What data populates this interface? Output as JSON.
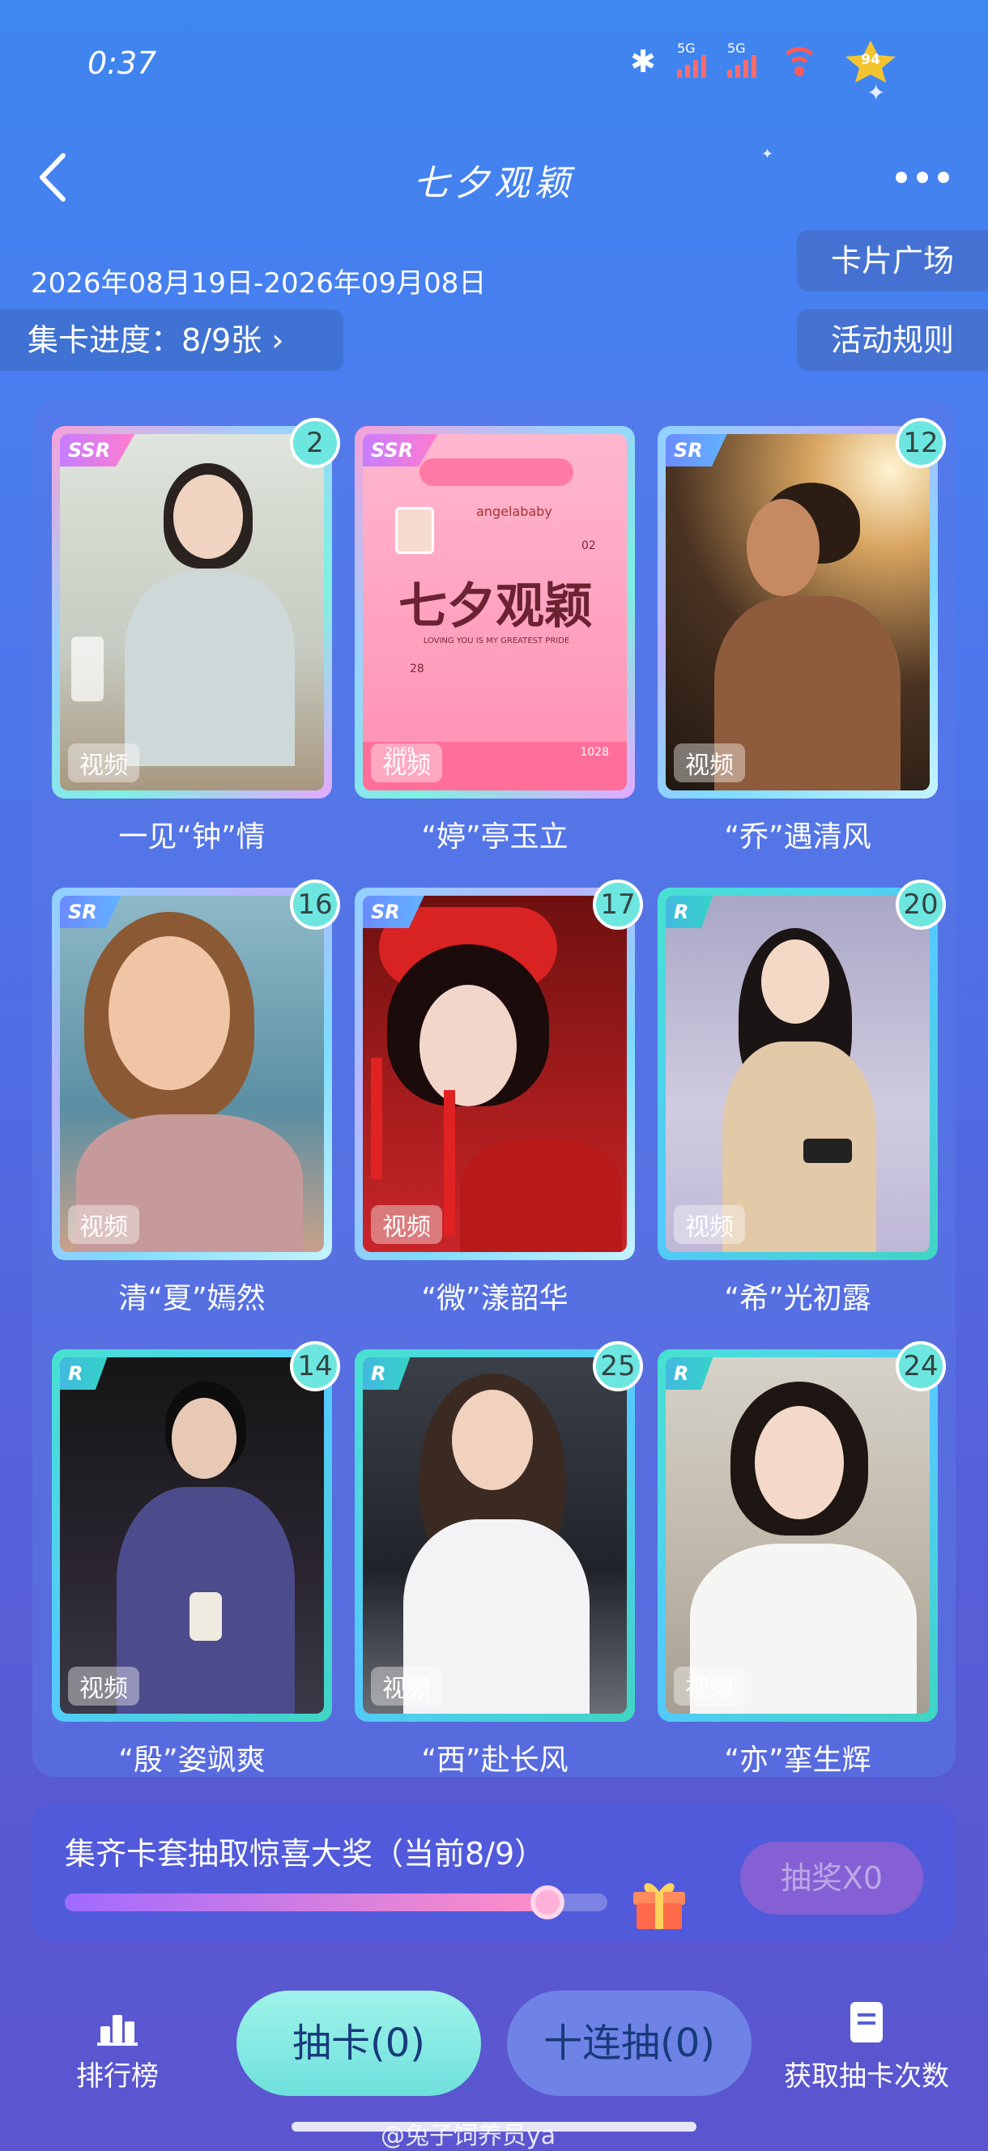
{
  "status_bar": {
    "time": "0:37",
    "signal1_label": "5G",
    "signal2_label": "5G",
    "battery": "94"
  },
  "header": {
    "title": "七夕观颖"
  },
  "event": {
    "date_range": "2026年08月19日-2026年09月08日",
    "progress_label": "集卡进度：8/9张",
    "card_plaza_label": "卡片广场",
    "rules_label": "活动规则"
  },
  "cards": [
    {
      "name": "一见“钟”情",
      "rarity": "SSR",
      "count": "2",
      "tag": "视频"
    },
    {
      "name": "“婷”亭玉立",
      "rarity": "SSR",
      "count": "",
      "tag": "视频",
      "art_title": "七夕观颖",
      "art_subtitle": "angelababy",
      "art_caption": "LOVING YOU IS MY GREATEST PRIDE",
      "art_left": "2069",
      "art_right": "1028",
      "art_badge_top": "02",
      "art_badge_bottom": "28"
    },
    {
      "name": "“乔”遇清风",
      "rarity": "SR",
      "count": "12",
      "tag": "视频"
    },
    {
      "name": "清“夏”嫣然",
      "rarity": "SR",
      "count": "16",
      "tag": "视频"
    },
    {
      "name": "“微”漾韶华",
      "rarity": "SR",
      "count": "17",
      "tag": "视频"
    },
    {
      "name": "“希”光初露",
      "rarity": "R",
      "count": "20",
      "tag": "视频"
    },
    {
      "name": "“殷”姿飒爽",
      "rarity": "R",
      "count": "14",
      "tag": "视频"
    },
    {
      "name": "“西”赴长风",
      "rarity": "R",
      "count": "25",
      "tag": "视频"
    },
    {
      "name": "“亦”挛生辉",
      "rarity": "R",
      "count": "24",
      "tag": "视频"
    }
  ],
  "reward": {
    "title": "集齐卡套抽取惊喜大奖（当前8/9）",
    "progress_fraction": 0.889,
    "lottery_label": "抽奖X0"
  },
  "bottom_bar": {
    "rank_label": "排行榜",
    "draw_label": "抽卡(0)",
    "draw_ten_label": "十连抽(0)",
    "get_count_label": "获取抽卡次数"
  },
  "watermark": "@兔子饲养员ya",
  "colors": {
    "accent_cyan": "#6de6e0",
    "bg_top": "#3f86ef",
    "bg_bottom": "#5b55cf"
  }
}
